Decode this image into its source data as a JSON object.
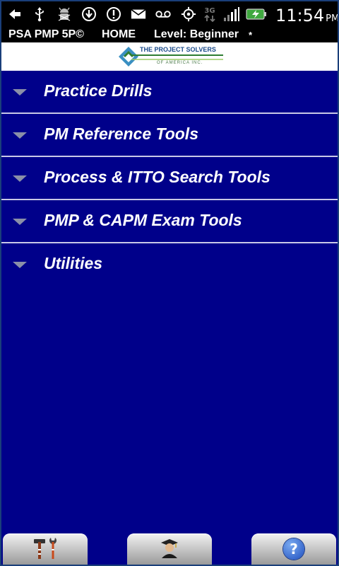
{
  "status_bar": {
    "icons_left": [
      "back-arrow-icon",
      "usb-icon",
      "android-debug-icon",
      "download-icon",
      "alert-icon",
      "mail-icon",
      "voicemail-icon"
    ],
    "icons_right": [
      "gps-icon",
      "3g-icon",
      "signal-icon",
      "battery-icon"
    ],
    "network_label": "3G",
    "time": "11:54",
    "ampm": "PM"
  },
  "title_bar": {
    "app": "PSA PMP 5P©",
    "screen": "HOME",
    "level": "Level: Beginner",
    "marker": "*"
  },
  "logo": {
    "text_top": "THE PROJECT SOLVERS",
    "text_bottom": "OF AMERICA INC."
  },
  "menu": {
    "items": [
      {
        "label": "Practice Drills"
      },
      {
        "label": "PM Reference Tools"
      },
      {
        "label": "Process & ITTO Search Tools"
      },
      {
        "label": "PMP & CAPM Exam Tools"
      },
      {
        "label": "Utilities"
      }
    ]
  },
  "bottom_bar": {
    "buttons": [
      {
        "icon": "tools-icon"
      },
      {
        "icon": "graduate-icon"
      },
      {
        "icon": "help-icon",
        "glyph": "?"
      }
    ]
  },
  "colors": {
    "background": "#00008a",
    "divider": "#c8c8e6",
    "status_bar": "#000000",
    "menu_text": "#ffffff"
  }
}
